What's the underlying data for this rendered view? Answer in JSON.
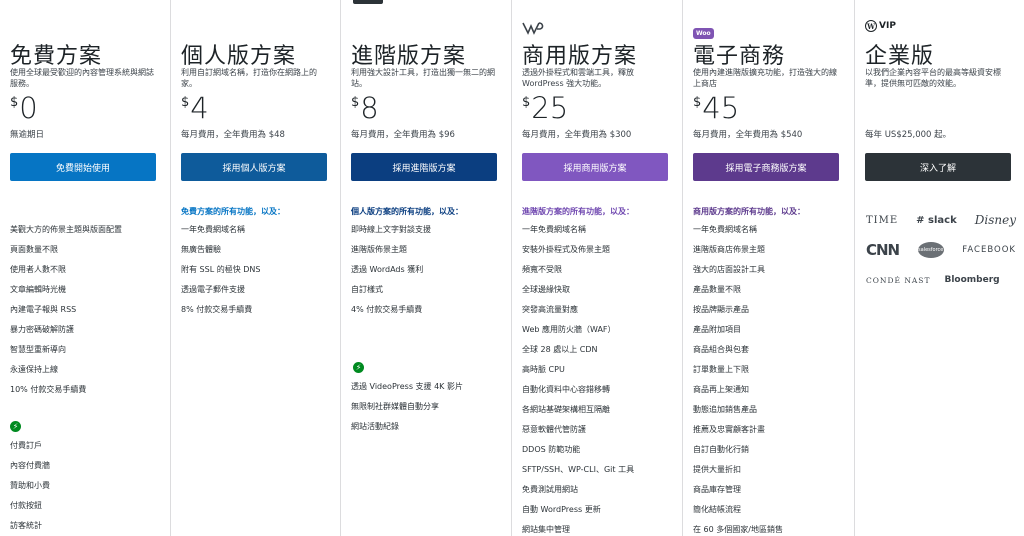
{
  "plans": [
    {
      "id": "free",
      "title": "免費方案",
      "desc": "使用全球最受歡迎的內容管理系統與網誌服務。",
      "currency": "$",
      "price": "0",
      "note": "無逾期日",
      "cta": "免費開始使用",
      "cta_color": "#0675c4",
      "features_head": "",
      "features": [
        "美觀大方的佈景主題與版面配置",
        "頁面數量不限",
        "使用者人數不限",
        "文章編輯時光機",
        "內建電子報與 RSS",
        "暴力密碼破解防護",
        "智慧型重新導向",
        "永遠保持上線",
        "10% 付款交易手續費"
      ],
      "extra": [
        "付費訂戶",
        "內容付費牆",
        "贊助和小費",
        "付款按鈕",
        "訪客統計"
      ]
    },
    {
      "id": "personal",
      "title": "個人版方案",
      "desc": "利用自訂網域名稱，打造你在網路上的家。",
      "currency": "$",
      "price": "4",
      "note": "每月費用，全年費用為 $48",
      "cta": "採用個人版方案",
      "cta_color": "#0e5b9b",
      "features_head": "免費方案的所有功能，以及：",
      "features_head_color": "#0675c4",
      "features": [
        "一年免費網域名稱",
        "無廣告體驗",
        "附有 SSL 的極快 DNS",
        "透過電子郵件支援",
        "8% 付款交易手續費"
      ],
      "extra": []
    },
    {
      "id": "premium",
      "title": "進階版方案",
      "desc": "利用強大設計工具，打造出獨一無二的網站。",
      "currency": "$",
      "price": "8",
      "note": "每月費用，全年費用為 $96",
      "cta": "採用進階版方案",
      "cta_color": "#0b3e80",
      "features_head": "個人版方案的所有功能，以及：",
      "features_head_color": "#0b3e80",
      "features": [
        "即時線上文字對談支援",
        "進階版佈景主題",
        "透過 WordAds 獲利",
        "自訂樣式",
        "4% 付款交易手續費"
      ],
      "extra": [
        "透過 VideoPress 支援 4K 影片",
        "無限制社群媒體自動分享",
        "網站活動紀錄"
      ]
    },
    {
      "id": "business",
      "title": "商用版方案",
      "desc": "透過外掛程式和雲端工具，釋放 WordPress 強大功能。",
      "currency": "$",
      "price": "25",
      "note": "每月費用，全年費用為 $300",
      "cta": "採用商用版方案",
      "cta_color": "#8057c0",
      "features_head": "進階版方案的所有功能，以及：",
      "features_head_color": "#7048b0",
      "features": [
        "一年免費網域名稱",
        "安裝外掛程式及佈景主題",
        "頻寬不受限",
        "全球邊緣快取",
        "突發高流量對應",
        "Web 應用防火牆（WAF）",
        "全球 28 處以上 CDN",
        "高時脈 CPU",
        "自動化資料中心容錯移轉",
        "各網站基礎架構相互隔離",
        "惡意軟體代管防護",
        "DDOS 防範功能",
        "SFTP/SSH、WP-CLI、Git 工具",
        "免費測試用網站",
        "自動 WordPress 更新",
        "網站集中管理"
      ],
      "extra": []
    },
    {
      "id": "ecommerce",
      "title": "電子商務",
      "desc": "使用內建進階版擴充功能，打造強大的線上商店",
      "currency": "$",
      "price": "45",
      "note": "每月費用，全年費用為 $540",
      "cta": "採用電子商務版方案",
      "cta_color": "#5d3a8d",
      "features_head": "商用版方案的所有功能，以及：",
      "features_head_color": "#5d3a8d",
      "features": [
        "一年免費網域名稱",
        "進階版商店佈景主題",
        "強大的店面設計工具",
        "產品數量不限",
        "按品牌顯示產品",
        "產品附加項目",
        "商品組合與包套",
        "訂單數量上下限",
        "商品再上架通知",
        "動態追加銷售產品",
        "推薦及忠實顧客計畫",
        "自訂自動化行銷",
        "提供大量折扣",
        "商品庫存管理",
        "簡化結帳流程",
        "在 60 多個國家/地區銷售"
      ],
      "extra": []
    },
    {
      "id": "enterprise",
      "title": "企業版",
      "desc": "以我們企業內容平台的最高等級資安標準，提供無可匹敵的效能。",
      "currency": "",
      "price": "",
      "note": "每年 US$25,000 起。",
      "cta": "深入了解",
      "cta_color": "#2c3338",
      "features_head": "",
      "features": [],
      "extra": []
    }
  ],
  "brand_badges": {
    "business_icon": "WP",
    "ecommerce_badge": "Woo",
    "enterprise_vip": "VIP",
    "enterprise_wp": "W"
  },
  "customer_logos": {
    "time": "TIME",
    "slack": "slack",
    "disney": "Disney",
    "cnn": "CNN",
    "salesforce": "salesforce",
    "facebook": "FACEBOOK",
    "conde_nast": "CONDÉ NAST",
    "bloomberg": "Bloomberg"
  },
  "icons": {
    "bolt": "lightning-bolt-icon",
    "slack_hash": "#"
  }
}
